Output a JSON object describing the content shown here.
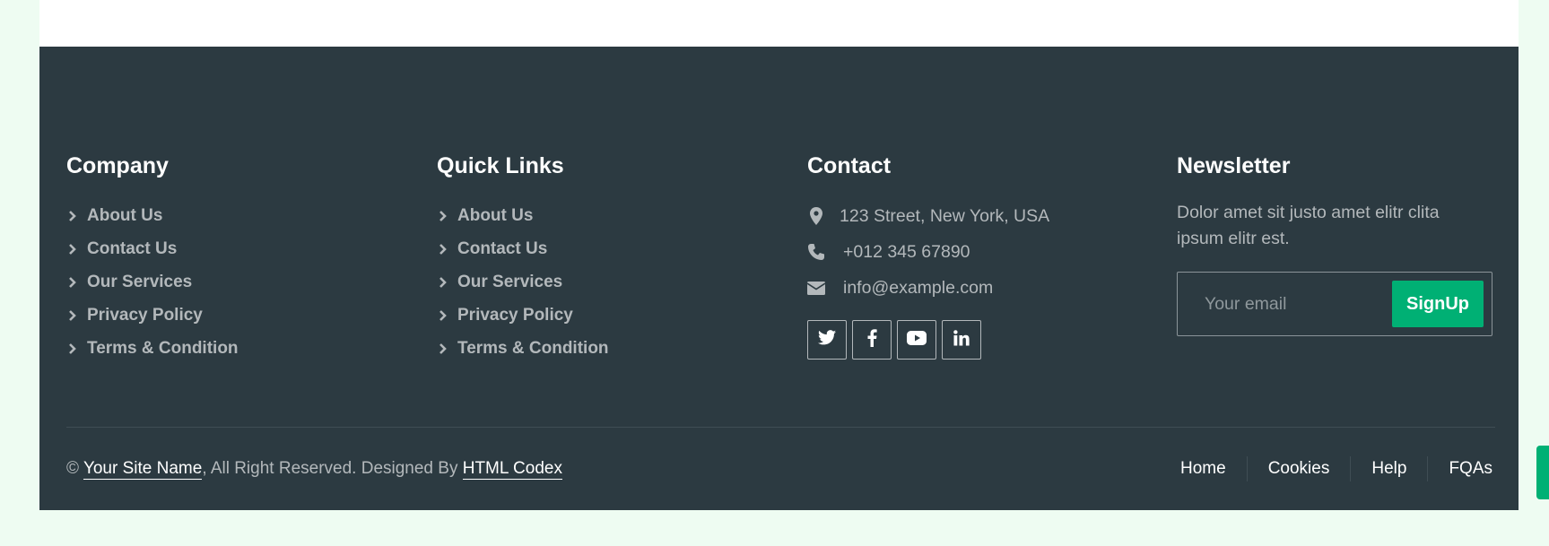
{
  "company": {
    "title": "Company",
    "links": [
      "About Us",
      "Contact Us",
      "Our Services",
      "Privacy Policy",
      "Terms & Condition"
    ]
  },
  "quick_links": {
    "title": "Quick Links",
    "links": [
      "About Us",
      "Contact Us",
      "Our Services",
      "Privacy Policy",
      "Terms & Condition"
    ]
  },
  "contact": {
    "title": "Contact",
    "address": "123 Street, New York, USA",
    "phone": "+012 345 67890",
    "email": "info@example.com",
    "socials": [
      "twitter-icon",
      "facebook-icon",
      "youtube-icon",
      "linkedin-icon"
    ]
  },
  "newsletter": {
    "title": "Newsletter",
    "text": "Dolor amet sit justo amet elitr clita ipsum elitr est.",
    "placeholder": "Your email",
    "button": "SignUp"
  },
  "footer_bottom": {
    "copyright_symbol": "©",
    "site_name": "Your Site Name",
    "reserved_text": ", All Right Reserved. Designed By",
    "designer": "HTML Codex",
    "nav": [
      "Home",
      "Cookies",
      "Help",
      "FQAs"
    ]
  },
  "colors": {
    "footer_bg": "#2C3A41",
    "accent": "#00B074",
    "page_bg": "#EEFCF2"
  }
}
